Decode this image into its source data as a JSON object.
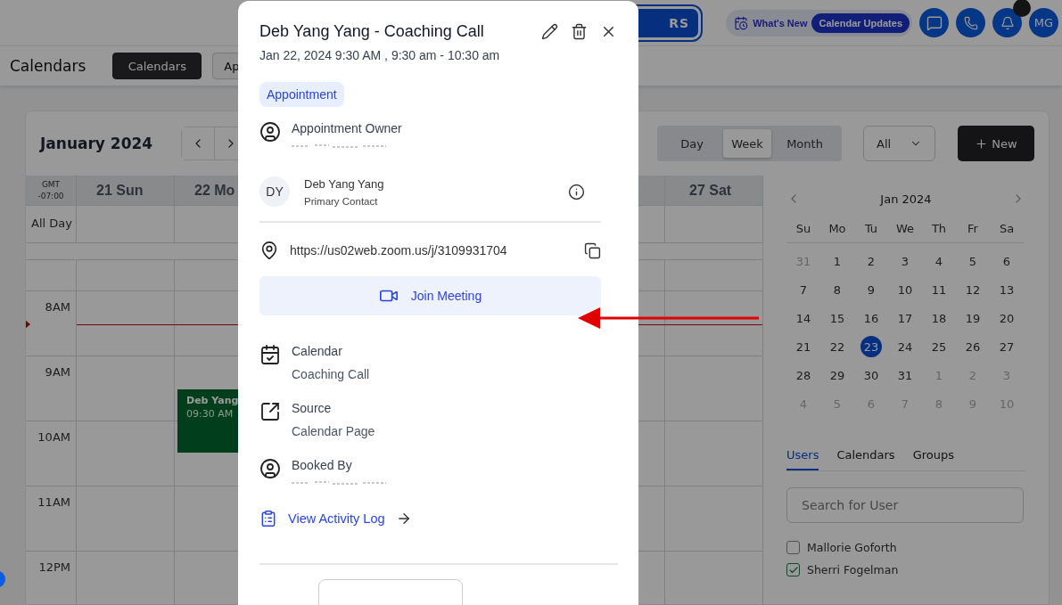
{
  "header": {
    "partial_button": "RS",
    "whats_new": "What's New",
    "badge": "Calendar Updates",
    "avatar": "MG"
  },
  "subheader": {
    "title": "Calendars",
    "tabs": [
      {
        "label": "Calendars",
        "selected": true
      },
      {
        "label": "Ap",
        "selected": false
      }
    ]
  },
  "calendar": {
    "title": "January 2024",
    "views": [
      {
        "label": "Day",
        "selected": false
      },
      {
        "label": "Week",
        "selected": true
      },
      {
        "label": "Month",
        "selected": false
      }
    ],
    "filter": "All",
    "new_button": "New",
    "timezone": "GMT -07:00",
    "all_day": "All Day",
    "day_headers": [
      "21 Sun",
      "22 Mo",
      "27 Sat"
    ],
    "hours": [
      "8AM",
      "9AM",
      "10AM",
      "11AM",
      "12PM"
    ],
    "event": {
      "title": "Deb Yang",
      "time": "09:30 AM"
    }
  },
  "mini_calendar": {
    "title": "Jan 2024",
    "weekdays": [
      "Su",
      "Mo",
      "Tu",
      "We",
      "Th",
      "Fr",
      "Sa"
    ],
    "weeks": [
      [
        {
          "day": "31",
          "muted": true,
          "selected": false
        },
        {
          "day": "1",
          "muted": false,
          "selected": false
        },
        {
          "day": "2",
          "muted": false,
          "selected": false
        },
        {
          "day": "3",
          "muted": false,
          "selected": false
        },
        {
          "day": "4",
          "muted": false,
          "selected": false
        },
        {
          "day": "5",
          "muted": false,
          "selected": false
        },
        {
          "day": "6",
          "muted": false,
          "selected": false
        }
      ],
      [
        {
          "day": "7",
          "muted": false,
          "selected": false
        },
        {
          "day": "8",
          "muted": false,
          "selected": false
        },
        {
          "day": "9",
          "muted": false,
          "selected": false
        },
        {
          "day": "10",
          "muted": false,
          "selected": false
        },
        {
          "day": "11",
          "muted": false,
          "selected": false
        },
        {
          "day": "12",
          "muted": false,
          "selected": false
        },
        {
          "day": "13",
          "muted": false,
          "selected": false
        }
      ],
      [
        {
          "day": "14",
          "muted": false,
          "selected": false
        },
        {
          "day": "15",
          "muted": false,
          "selected": false
        },
        {
          "day": "16",
          "muted": false,
          "selected": false
        },
        {
          "day": "17",
          "muted": false,
          "selected": false
        },
        {
          "day": "18",
          "muted": false,
          "selected": false
        },
        {
          "day": "19",
          "muted": false,
          "selected": false
        },
        {
          "day": "20",
          "muted": false,
          "selected": false
        }
      ],
      [
        {
          "day": "21",
          "muted": false,
          "selected": false
        },
        {
          "day": "22",
          "muted": false,
          "selected": false
        },
        {
          "day": "23",
          "muted": false,
          "selected": true
        },
        {
          "day": "24",
          "muted": false,
          "selected": false
        },
        {
          "day": "25",
          "muted": false,
          "selected": false
        },
        {
          "day": "26",
          "muted": false,
          "selected": false
        },
        {
          "day": "27",
          "muted": false,
          "selected": false
        }
      ],
      [
        {
          "day": "28",
          "muted": false,
          "selected": false
        },
        {
          "day": "29",
          "muted": false,
          "selected": false
        },
        {
          "day": "30",
          "muted": false,
          "selected": false
        },
        {
          "day": "31",
          "muted": false,
          "selected": false
        },
        {
          "day": "1",
          "muted": true,
          "selected": false
        },
        {
          "day": "2",
          "muted": true,
          "selected": false
        },
        {
          "day": "3",
          "muted": true,
          "selected": false
        }
      ],
      [
        {
          "day": "4",
          "muted": true,
          "selected": false
        },
        {
          "day": "5",
          "muted": true,
          "selected": false
        },
        {
          "day": "6",
          "muted": true,
          "selected": false
        },
        {
          "day": "7",
          "muted": true,
          "selected": false
        },
        {
          "day": "8",
          "muted": true,
          "selected": false
        },
        {
          "day": "9",
          "muted": true,
          "selected": false
        },
        {
          "day": "10",
          "muted": true,
          "selected": false
        }
      ]
    ]
  },
  "user_tabs": [
    {
      "label": "Users",
      "selected": true
    },
    {
      "label": "Calendars",
      "selected": false
    },
    {
      "label": "Groups",
      "selected": false
    }
  ],
  "user_search": {
    "placeholder": "Search for User"
  },
  "users": [
    {
      "name": "Mallorie Goforth",
      "checked": false
    },
    {
      "name": "Sherri Fogelman",
      "checked": true
    }
  ],
  "modal": {
    "title": "Deb Yang Yang - Coaching Call",
    "datetime": "Jan 22, 2024 9:30 AM , 9:30 am - 10:30 am",
    "tag": "Appointment",
    "owner_label": "Appointment Owner",
    "contact": {
      "initials": "DY",
      "name": "Deb Yang Yang",
      "role": "Primary Contact"
    },
    "location": "https://us02web.zoom.us/j/3109931704",
    "join_button": "Join Meeting",
    "details": [
      {
        "kind": "calendar",
        "label": "Calendar",
        "value": "Coaching Call"
      },
      {
        "kind": "source",
        "label": "Source",
        "value": "Calendar Page"
      }
    ],
    "booked_label": "Booked By",
    "activity_link": "View Activity Log"
  }
}
